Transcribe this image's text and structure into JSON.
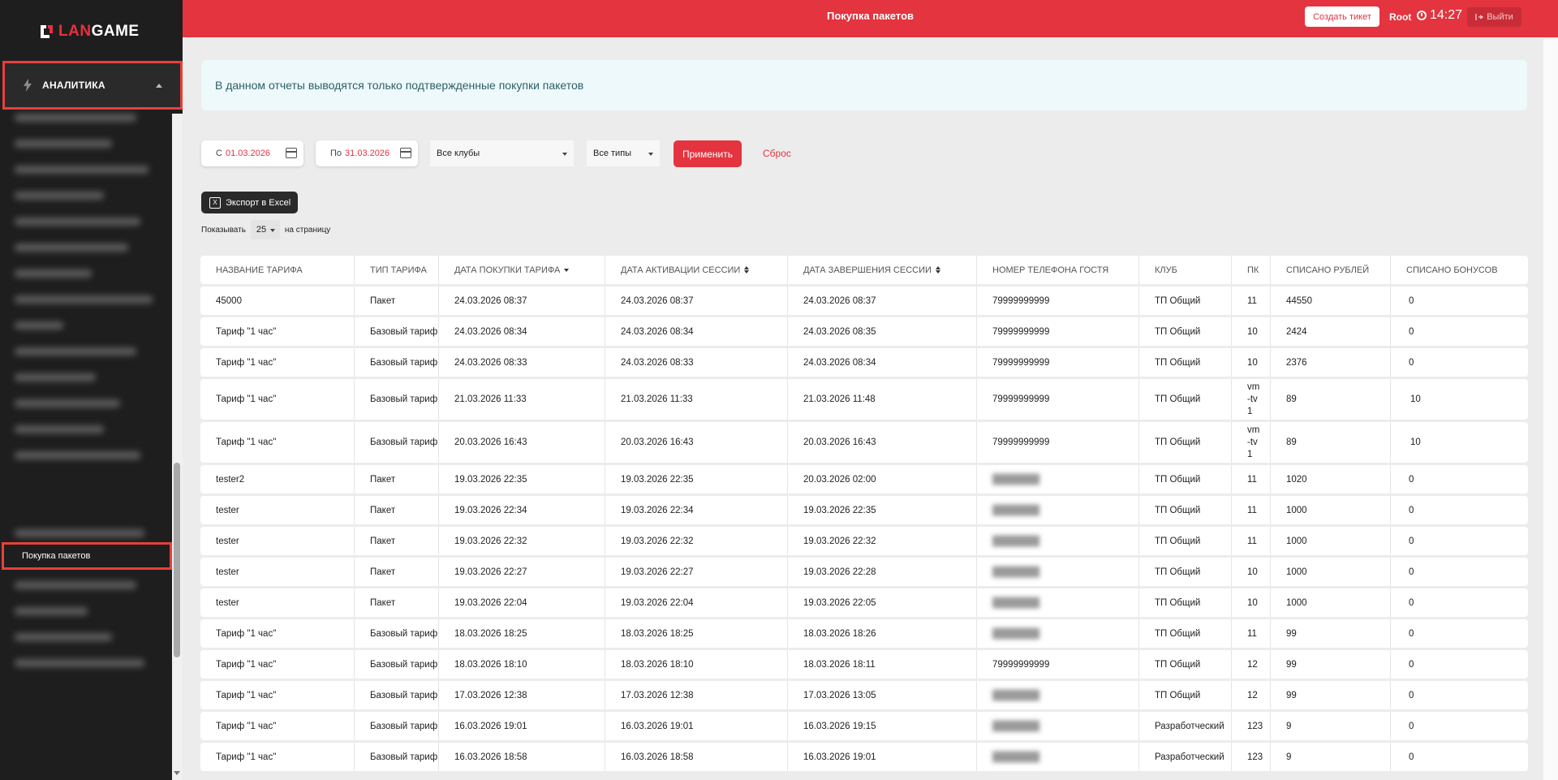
{
  "app": {
    "logo_text_left": "LAN",
    "logo_text_right": "GAME",
    "accent_color": "#e3343f"
  },
  "sidebar": {
    "section_label": "АНАЛИТИКА",
    "active_item": "Покупка пакетов",
    "section_icon": "lightning-icon"
  },
  "topbar": {
    "title": "Покупка пакетов",
    "ticket_button": "Создать тикет",
    "user": "Root",
    "time": "14:27",
    "logout_button": "Выйти"
  },
  "notice": "В данном отчеты выводятся только подтвержденные покупки пакетов",
  "filters": {
    "from_prefix": "С",
    "from_value": "01.03.2026",
    "to_prefix": "По",
    "to_value": "31.03.2026",
    "club_select": "Все клубы",
    "type_select": "Все типы",
    "apply_button": "Применить",
    "reset_link": "Сброс"
  },
  "export_button": "Экспорт в Excel",
  "pagination": {
    "show_label": "Показывать",
    "per_page": "25",
    "per_page_suffix": "на страницу"
  },
  "table": {
    "columns": [
      "НАЗВАНИЕ ТАРИФА",
      "ТИП ТАРИФА",
      "ДАТА ПОКУПКИ ТАРИФА",
      "ДАТА АКТИВАЦИИ СЕССИИ",
      "ДАТА ЗАВЕРШЕНИЯ СЕССИИ",
      "НОМЕР ТЕЛЕФОНА ГОСТЯ",
      "КЛУБ",
      "ПК",
      "СПИСАНО РУБЛЕЙ",
      "СПИСАНО БОНУСОВ"
    ],
    "rows": [
      [
        "45000",
        "Пакет",
        "24.03.2026 08:37",
        "24.03.2026 08:37",
        "24.03.2026 08:37",
        "79999999999",
        "ТП Общий",
        "11",
        "44550",
        "0"
      ],
      [
        "Тариф \"1 час\"",
        "Базовый тариф",
        "24.03.2026 08:34",
        "24.03.2026 08:34",
        "24.03.2026 08:35",
        "79999999999",
        "ТП Общий",
        "10",
        "2424",
        "0"
      ],
      [
        "Тариф \"1 час\"",
        "Базовый тариф",
        "24.03.2026 08:33",
        "24.03.2026 08:33",
        "24.03.2026 08:34",
        "79999999999",
        "ТП Общий",
        "10",
        "2376",
        "0"
      ],
      [
        "Тариф \"1 час\"",
        "Базовый тариф",
        "21.03.2026 11:33",
        "21.03.2026 11:33",
        "21.03.2026 11:48",
        "79999999999",
        "ТП Общий",
        "vm-tv1",
        "89",
        "10"
      ],
      [
        "Тариф \"1 час\"",
        "Базовый тариф",
        "20.03.2026 16:43",
        "20.03.2026 16:43",
        "20.03.2026 16:43",
        "79999999999",
        "ТП Общий",
        "vm-tv1",
        "89",
        "10"
      ],
      [
        "tester2",
        "Пакет",
        "19.03.2026 22:35",
        "19.03.2026 22:35",
        "20.03.2026 02:00",
        "",
        "ТП Общий",
        "11",
        "1020",
        "0"
      ],
      [
        "tester",
        "Пакет",
        "19.03.2026 22:34",
        "19.03.2026 22:34",
        "19.03.2026 22:35",
        "",
        "ТП Общий",
        "11",
        "1000",
        "0"
      ],
      [
        "tester",
        "Пакет",
        "19.03.2026 22:32",
        "19.03.2026 22:32",
        "19.03.2026 22:32",
        "",
        "ТП Общий",
        "11",
        "1000",
        "0"
      ],
      [
        "tester",
        "Пакет",
        "19.03.2026 22:27",
        "19.03.2026 22:27",
        "19.03.2026 22:28",
        "",
        "ТП Общий",
        "10",
        "1000",
        "0"
      ],
      [
        "tester",
        "Пакет",
        "19.03.2026 22:04",
        "19.03.2026 22:04",
        "19.03.2026 22:05",
        "",
        "ТП Общий",
        "10",
        "1000",
        "0"
      ],
      [
        "Тариф \"1 час\"",
        "Базовый тариф",
        "18.03.2026 18:25",
        "18.03.2026 18:25",
        "18.03.2026 18:26",
        "",
        "ТП Общий",
        "11",
        "99",
        "0"
      ],
      [
        "Тариф \"1 час\"",
        "Базовый тариф",
        "18.03.2026 18:10",
        "18.03.2026 18:10",
        "18.03.2026 18:11",
        "79999999999",
        "ТП Общий",
        "12",
        "99",
        "0"
      ],
      [
        "Тариф \"1 час\"",
        "Базовый тариф",
        "17.03.2026 12:38",
        "17.03.2026 12:38",
        "17.03.2026 13:05",
        "",
        "ТП Общий",
        "12",
        "99",
        "0"
      ],
      [
        "Тариф \"1 час\"",
        "Базовый тариф",
        "16.03.2026 19:01",
        "16.03.2026 19:01",
        "16.03.2026 19:15",
        "",
        "Разработческий",
        "123",
        "9",
        "0"
      ],
      [
        "Тариф \"1 час\"",
        "Базовый тариф",
        "16.03.2026 18:58",
        "16.03.2026 18:58",
        "16.03.2026 19:01",
        "",
        "Разработческий",
        "123",
        "9",
        "0"
      ]
    ]
  }
}
